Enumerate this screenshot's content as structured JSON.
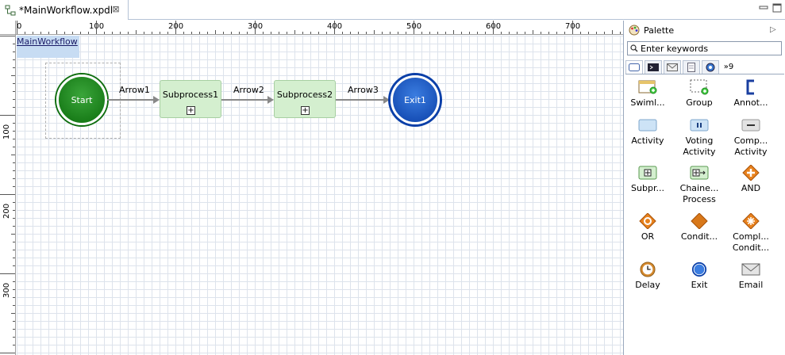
{
  "tab": {
    "title": "*MainWorkflow.xpdl",
    "close_glyph": "⊠"
  },
  "ruler": {
    "top": [
      "0",
      "100",
      "200",
      "300",
      "400",
      "500",
      "600",
      "700"
    ],
    "left": [
      "100",
      "200",
      "300"
    ]
  },
  "diagram": {
    "pool_name": "MainWorkflow",
    "start": "Start",
    "exit": "Exit1",
    "subprocess1": "Subprocess1",
    "subprocess2": "Subprocess2",
    "arrow1": "Arrow1",
    "arrow2": "Arrow2",
    "arrow3": "Arrow3",
    "expand_glyph": "+"
  },
  "palette": {
    "title": "Palette",
    "search_placeholder": "Enter keywords",
    "more_tabs": "»9",
    "items": [
      {
        "label": "Swiml...",
        "icon": "swimlane-icon"
      },
      {
        "label": "Group",
        "icon": "group-icon"
      },
      {
        "label": "Annot...",
        "icon": "annotation-icon"
      },
      {
        "label": "Activity",
        "icon": "activity-icon"
      },
      {
        "label": "Voting Activity",
        "icon": "voting-activity-icon"
      },
      {
        "label": "Comp... Activity",
        "icon": "compound-activity-icon"
      },
      {
        "label": "Subpr...",
        "icon": "subprocess-icon"
      },
      {
        "label": "Chaine... Process",
        "icon": "chained-process-icon"
      },
      {
        "label": "AND",
        "icon": "and-gateway-icon"
      },
      {
        "label": "OR",
        "icon": "or-gateway-icon"
      },
      {
        "label": "Condit...",
        "icon": "conditional-gateway-icon"
      },
      {
        "label": "Compl... Condit...",
        "icon": "complex-gateway-icon"
      },
      {
        "label": "Delay",
        "icon": "delay-icon"
      },
      {
        "label": "Exit",
        "icon": "exit-icon"
      },
      {
        "label": "Email",
        "icon": "email-icon"
      }
    ]
  }
}
